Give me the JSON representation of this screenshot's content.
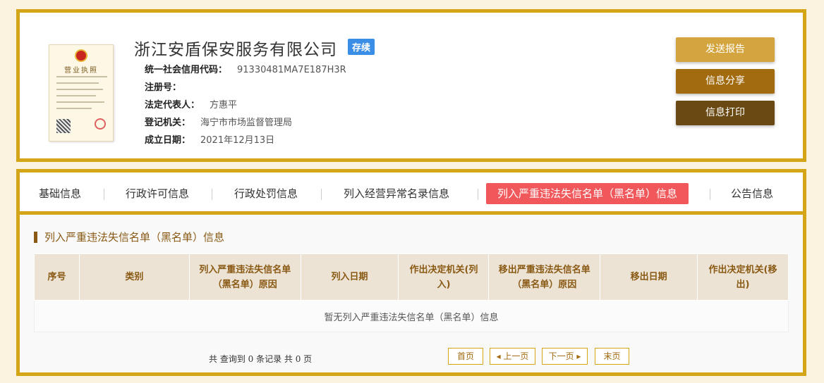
{
  "company": {
    "name": "浙江安盾保安服务有限公司",
    "status": "存续",
    "license_title": "营业执照"
  },
  "info": [
    {
      "label": "统一社会信用代码：",
      "value": "91330481MA7E187H3R"
    },
    {
      "label": "注册号：",
      "value": ""
    },
    {
      "label": "法定代表人：",
      "value": "方惠平"
    },
    {
      "label": "登记机关：",
      "value": "海宁市市场监督管理局"
    },
    {
      "label": "成立日期：",
      "value": "2021年12月13日"
    }
  ],
  "actions": {
    "report": "发送报告",
    "share": "信息分享",
    "print": "信息打印"
  },
  "tabs": [
    "基础信息",
    "行政许可信息",
    "行政处罚信息",
    "列入经营异常名录信息",
    "列入严重违法失信名单（黑名单）信息",
    "公告信息"
  ],
  "section": {
    "title": "列入严重违法失信名单（黑名单）信息"
  },
  "table": {
    "headers": [
      "序号",
      "类别",
      "列入严重违法失信名单（黑名单）原因",
      "列入日期",
      "作出决定机关(列入)",
      "移出严重违法失信名单（黑名单）原因",
      "移出日期",
      "作出决定机关(移出)"
    ],
    "empty": "暂无列入严重违法失信名单（黑名单）信息"
  },
  "pager": {
    "summary": "共 查询到 0 条记录 共 0 页",
    "first": "首页",
    "prev": "◂ 上一页",
    "next": "下一页 ▸",
    "last": "末页"
  },
  "colors": {
    "gold_border": "#d4a617",
    "active_tab": "#f0585b",
    "badge": "#3a8ee6",
    "report_btn": "#d4a53f",
    "share_btn": "#a26b10",
    "print_btn": "#6a4a12"
  }
}
